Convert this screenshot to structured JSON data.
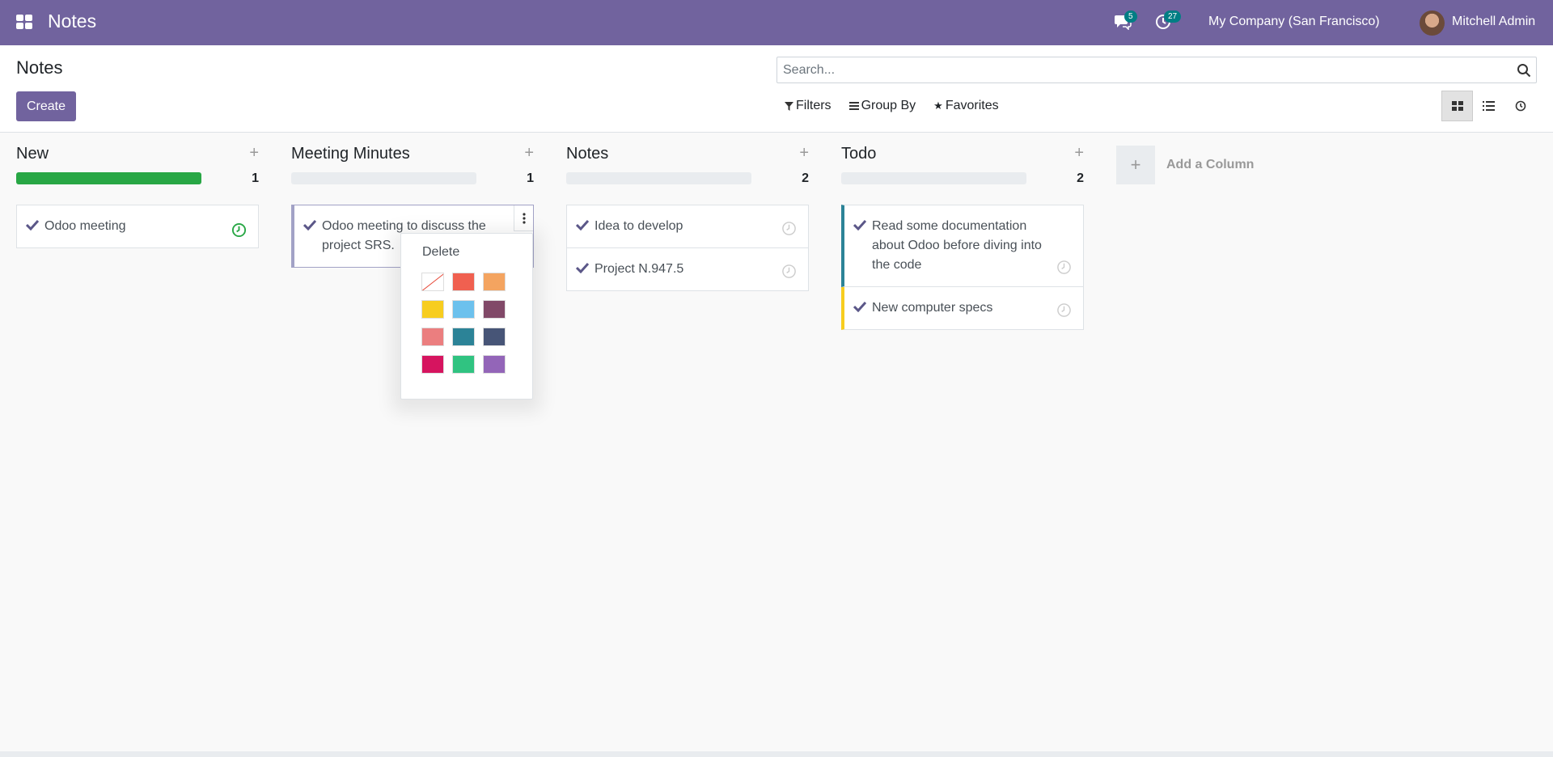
{
  "navbar": {
    "app_title": "Notes",
    "chat_badge": "5",
    "activity_badge": "27",
    "company": "My Company (San Francisco)",
    "user": "Mitchell Admin"
  },
  "control_panel": {
    "title": "Notes",
    "create_label": "Create",
    "search_placeholder": "Search...",
    "filters_label": "Filters",
    "groupby_label": "Group By",
    "favorites_label": "Favorites"
  },
  "columns": [
    {
      "title": "New",
      "count": "1",
      "progress": 1.0,
      "cards": [
        {
          "text": "Odoo meeting",
          "activity": "green"
        }
      ]
    },
    {
      "title": "Meeting Minutes",
      "count": "1",
      "progress": 0,
      "cards": [
        {
          "text": "Odoo meeting to discuss the project SRS.",
          "color": "#f4a460"
        }
      ]
    },
    {
      "title": "Notes",
      "count": "2",
      "progress": 0,
      "cards": [
        {
          "text": "Idea to develop"
        },
        {
          "text": "Project N.947.5"
        }
      ]
    },
    {
      "title": "Todo",
      "count": "2",
      "progress": 0,
      "cards": [
        {
          "text": "Read some documentation about Odoo before diving into the code",
          "color": "#2c8397"
        },
        {
          "text": "New computer specs",
          "color": "#f7cd1f"
        }
      ]
    }
  ],
  "add_column_label": "Add a Column",
  "dropdown": {
    "delete_label": "Delete",
    "colors": [
      "none",
      "#f06050",
      "#f4a460",
      "#f7cd1f",
      "#6cc1ed",
      "#814968",
      "#eb7e7f",
      "#2c8397",
      "#475577",
      "#d6145f",
      "#30c381",
      "#9365b8"
    ]
  },
  "accent_color": "#71639e"
}
